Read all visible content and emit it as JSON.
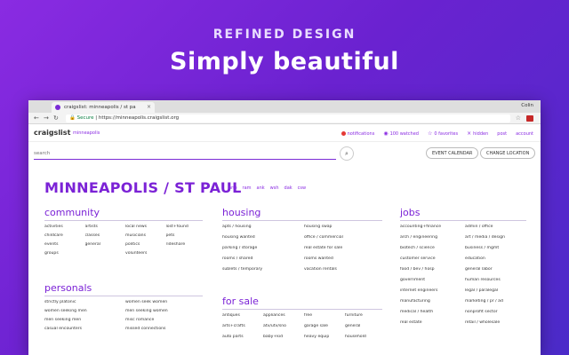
{
  "hero": {
    "subtitle": "REFINED DESIGN",
    "title": "Simply beautiful"
  },
  "browser": {
    "tab_title": "craigslist: minneapolis / st pa",
    "user": "Colin",
    "secure_label": "Secure",
    "url": "https://minneapolis.craigslist.org"
  },
  "site": {
    "logo": "craigslist",
    "city_link": "minneapolis",
    "notifications": "notifications",
    "watched": "100 watched",
    "favorites": "0 favorites",
    "hidden": "hidden",
    "post": "post",
    "account": "account"
  },
  "search": {
    "placeholder": "search",
    "event_calendar": "EVENT CALENDAR",
    "change_location": "CHANGE LOCATION"
  },
  "city": {
    "title": "MINNEAPOLIS / ST PAUL",
    "nearby": [
      "hnp",
      "ram",
      "ank",
      "wsh",
      "dak",
      "csw"
    ]
  },
  "community": {
    "title": "community",
    "items": [
      "activities",
      "artists",
      "local news",
      "lost+found",
      "childcare",
      "classes",
      "musicians",
      "pets",
      "events",
      "general",
      "politics",
      "rideshare",
      "groups",
      "",
      "volunteers",
      ""
    ]
  },
  "personals": {
    "title": "personals",
    "items": [
      "strictly platonic",
      "women seek women",
      "women seeking men",
      "men seeking women",
      "men seeking men",
      "misc romance",
      "casual encounters",
      "missed connections"
    ]
  },
  "housing": {
    "title": "housing",
    "items": [
      "apts / housing",
      "housing swap",
      "housing wanted",
      "office / commercial",
      "parking / storage",
      "real estate for sale",
      "rooms / shared",
      "rooms wanted",
      "sublets / temporary",
      "vacation rentals"
    ]
  },
  "for_sale": {
    "title": "for sale",
    "items": [
      "antiques",
      "appliances",
      "free",
      "furniture",
      "arts+crafts",
      "atv/utv/sno",
      "garage sale",
      "general",
      "auto parts",
      "baby+kid",
      "heavy equip",
      "household"
    ]
  },
  "jobs": {
    "title": "jobs",
    "items": [
      "accounting+finance",
      "admin / office",
      "arch / engineering",
      "art / media / design",
      "biotech / science",
      "business / mgmt",
      "customer service",
      "education",
      "food / bev / hosp",
      "general labor",
      "government",
      "human resources",
      "internet engineers",
      "legal / paralegal",
      "manufacturing",
      "marketing / pr / ad",
      "medical / health",
      "nonprofit sector",
      "real estate",
      "retail / wholesale"
    ]
  },
  "colors": {
    "accent": "#7b22d6",
    "background_start": "#8a2be2",
    "background_end": "#4b2bc9"
  }
}
